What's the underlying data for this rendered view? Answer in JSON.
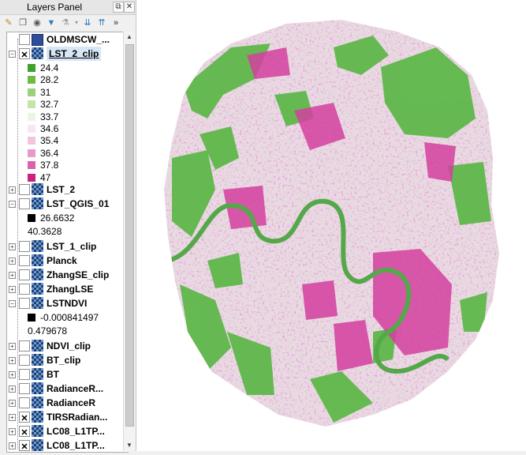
{
  "panel": {
    "title": "Layers Panel",
    "float_icon": "restore-icon",
    "close_icon": "close-icon"
  },
  "toolbar": {
    "icons": [
      "paint-brush-icon",
      "add-group-icon",
      "eye-icon",
      "filter-icon",
      "filter-legend-icon",
      "expand-all-icon",
      "collapse-all-icon",
      "more-icon"
    ]
  },
  "layers": [
    {
      "name": "OLDMSCW_...",
      "checked": false,
      "icon": "vector-polygon-icon",
      "expander": ""
    },
    {
      "name": "LST_2_clip",
      "checked": true,
      "icon": "raster-icon",
      "expander": "−",
      "selected": true
    },
    {
      "name": "LST_2",
      "checked": false,
      "icon": "raster-icon",
      "expander": "+"
    },
    {
      "name": "LST_QGIS_01",
      "checked": false,
      "icon": "raster-icon",
      "expander": "−"
    },
    {
      "name": "LST_1_clip",
      "checked": false,
      "icon": "raster-icon",
      "expander": "+"
    },
    {
      "name": "Planck",
      "checked": false,
      "icon": "raster-icon",
      "expander": "+"
    },
    {
      "name": "ZhangSE_clip",
      "checked": false,
      "icon": "raster-icon",
      "expander": "+"
    },
    {
      "name": "ZhangLSE",
      "checked": false,
      "icon": "raster-icon",
      "expander": "+"
    },
    {
      "name": "LSTNDVI",
      "checked": false,
      "icon": "raster-icon",
      "expander": "−"
    },
    {
      "name": "NDVI_clip",
      "checked": false,
      "icon": "raster-icon",
      "expander": "+"
    },
    {
      "name": "BT_clip",
      "checked": false,
      "icon": "raster-icon",
      "expander": "+"
    },
    {
      "name": "BT",
      "checked": false,
      "icon": "raster-icon",
      "expander": "+"
    },
    {
      "name": "RadianceR...",
      "checked": false,
      "icon": "raster-icon",
      "expander": "+"
    },
    {
      "name": "RadianceR",
      "checked": false,
      "icon": "raster-icon",
      "expander": "+"
    },
    {
      "name": "TIRSRadian...",
      "checked": true,
      "icon": "raster-icon",
      "expander": "+"
    },
    {
      "name": "LC08_L1TP...",
      "checked": true,
      "icon": "raster-icon",
      "expander": "+"
    },
    {
      "name": "LC08_L1TP...",
      "checked": true,
      "icon": "raster-icon",
      "expander": "+"
    }
  ],
  "legend_lst2clip": [
    {
      "value": "24.4",
      "color": "#3ea12b"
    },
    {
      "value": "28.2",
      "color": "#6cbb45"
    },
    {
      "value": "31",
      "color": "#9ad17a"
    },
    {
      "value": "32.7",
      "color": "#c4e4aa"
    },
    {
      "value": "33.7",
      "color": "#eef4e5"
    },
    {
      "value": "34.6",
      "color": "#f9e6f0"
    },
    {
      "value": "35.4",
      "color": "#f3c4de"
    },
    {
      "value": "36.4",
      "color": "#e89ac8"
    },
    {
      "value": "37.8",
      "color": "#d963ad"
    },
    {
      "value": "47",
      "color": "#c8237f"
    }
  ],
  "legend_qgis01": {
    "min": "26.6632",
    "max": "40.3628",
    "color": "#000000"
  },
  "legend_lstndvi": {
    "min": "-0.000841497",
    "max": "0.479678",
    "color": "#000000"
  },
  "map": {
    "colors": {
      "green": "#5fb84a",
      "light_green": "#cfe8b8",
      "pink": "#e070bf",
      "magenta": "#d43f9f"
    }
  }
}
